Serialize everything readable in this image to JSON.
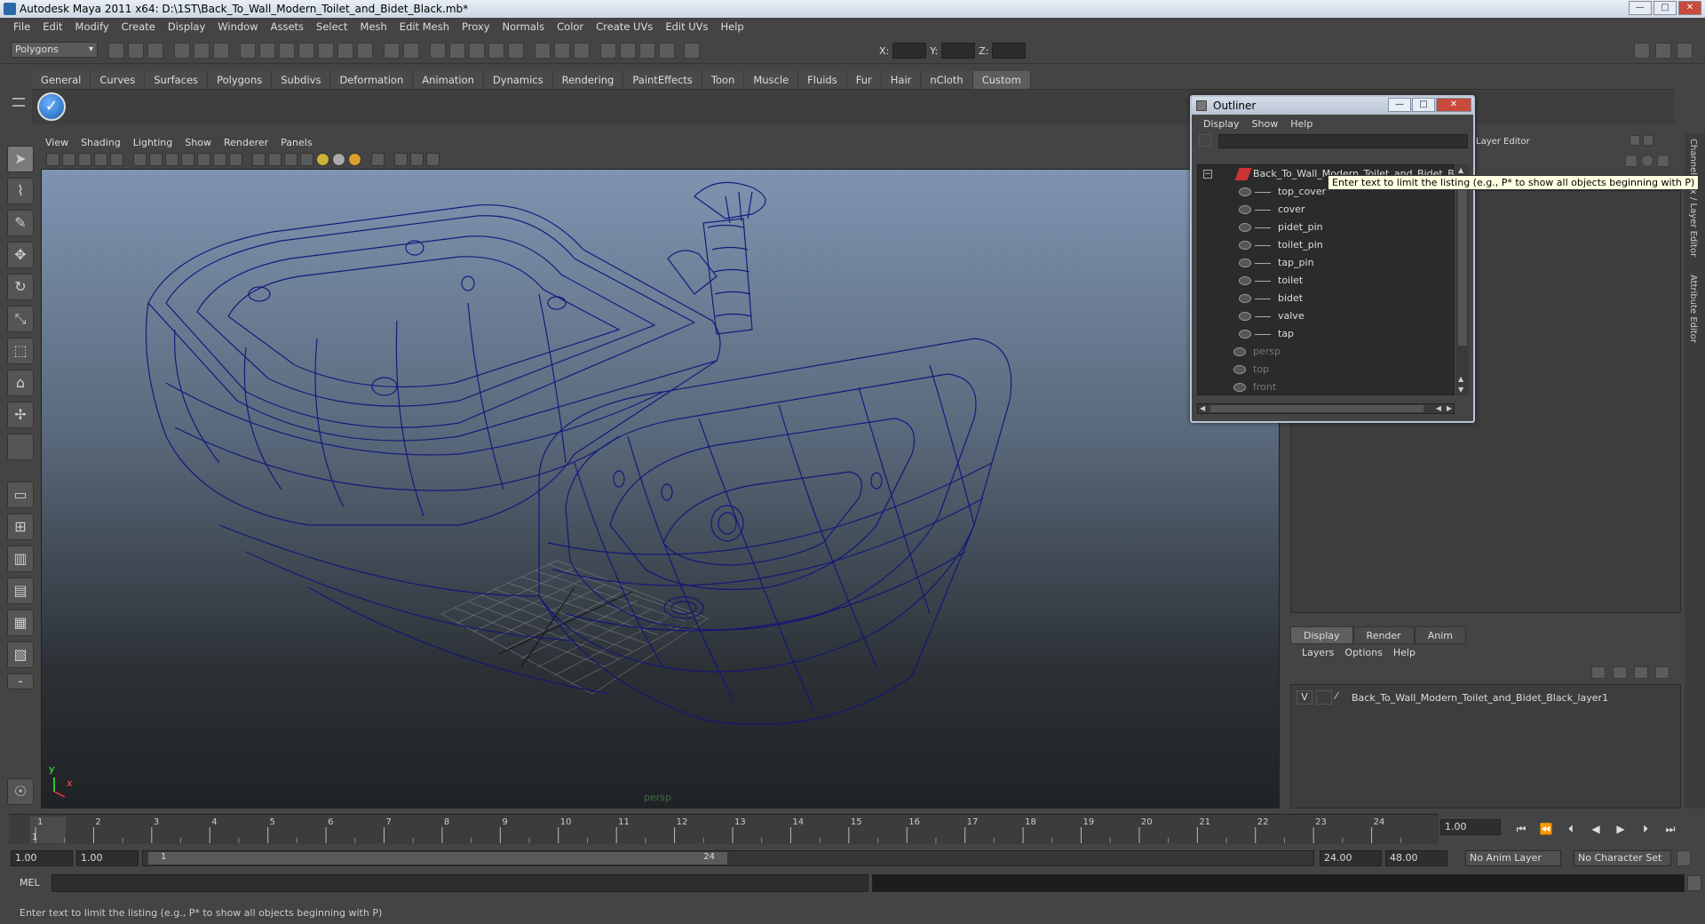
{
  "window": {
    "title": "Autodesk Maya 2011 x64: D:\\1ST\\Back_To_Wall_Modern_Toilet_and_Bidet_Black.mb*"
  },
  "menubar": [
    "File",
    "Edit",
    "Modify",
    "Create",
    "Display",
    "Window",
    "Assets",
    "Select",
    "Mesh",
    "Edit Mesh",
    "Proxy",
    "Normals",
    "Color",
    "Create UVs",
    "Edit UVs",
    "Help"
  ],
  "status": {
    "mode": "Polygons",
    "x_label": "X:",
    "y_label": "Y:",
    "z_label": "Z:"
  },
  "shelf_tabs": [
    "General",
    "Curves",
    "Surfaces",
    "Polygons",
    "Subdivs",
    "Deformation",
    "Animation",
    "Dynamics",
    "Rendering",
    "PaintEffects",
    "Toon",
    "Muscle",
    "Fluids",
    "Fur",
    "Hair",
    "nCloth",
    "Custom"
  ],
  "shelf_active": "Custom",
  "panel_menu": [
    "View",
    "Shading",
    "Lighting",
    "Show",
    "Renderer",
    "Panels"
  ],
  "viewport": {
    "camera_label": "persp",
    "axis_y": "y",
    "axis_x": "x"
  },
  "timeline": {
    "ticks": [
      "1",
      "2",
      "3",
      "4",
      "5",
      "6",
      "7",
      "8",
      "9",
      "10",
      "11",
      "12",
      "13",
      "14",
      "15",
      "16",
      "17",
      "18",
      "19",
      "20",
      "21",
      "22",
      "23",
      "24"
    ],
    "current_frame_marker": "1",
    "current_time": "1.00"
  },
  "range": {
    "start_time": "1.00",
    "playback_start": "1.00",
    "range_start_label": "1",
    "range_end_label": "24",
    "playback_end": "24.00",
    "end_time": "48.00",
    "anim_layer": "No Anim Layer",
    "character_set": "No Character Set"
  },
  "cmdline": {
    "label": "MEL"
  },
  "helpline": {
    "text": "Enter text to limit the listing (e.g., P* to show all objects beginning with P)"
  },
  "right_panel": {
    "header": "Layer Editor",
    "tabs": [
      "Display",
      "Render",
      "Anim"
    ],
    "active_tab": "Display",
    "layer_menu": [
      "Layers",
      "Options",
      "Help"
    ],
    "layer_row": {
      "visibility": "V",
      "name": "Back_To_Wall_Modern_Toilet_and_Bidet_Black_layer1"
    },
    "vtabs": [
      "Channel Box / Layer Editor",
      "Attribute Editor"
    ]
  },
  "outliner": {
    "title": "Outliner",
    "menu": [
      "Display",
      "Show",
      "Help"
    ],
    "root": "Back_To_Wall_Modern_Toilet_and_Bidet_Black",
    "children": [
      "top_cover",
      "cover",
      "pidet_pin",
      "toilet_pin",
      "tap_pin",
      "toilet",
      "bidet",
      "valve",
      "tap"
    ],
    "cameras": [
      "persp",
      "top",
      "front"
    ],
    "tooltip": "Enter text to limit the listing (e.g., P* to show all objects beginning with P)"
  }
}
